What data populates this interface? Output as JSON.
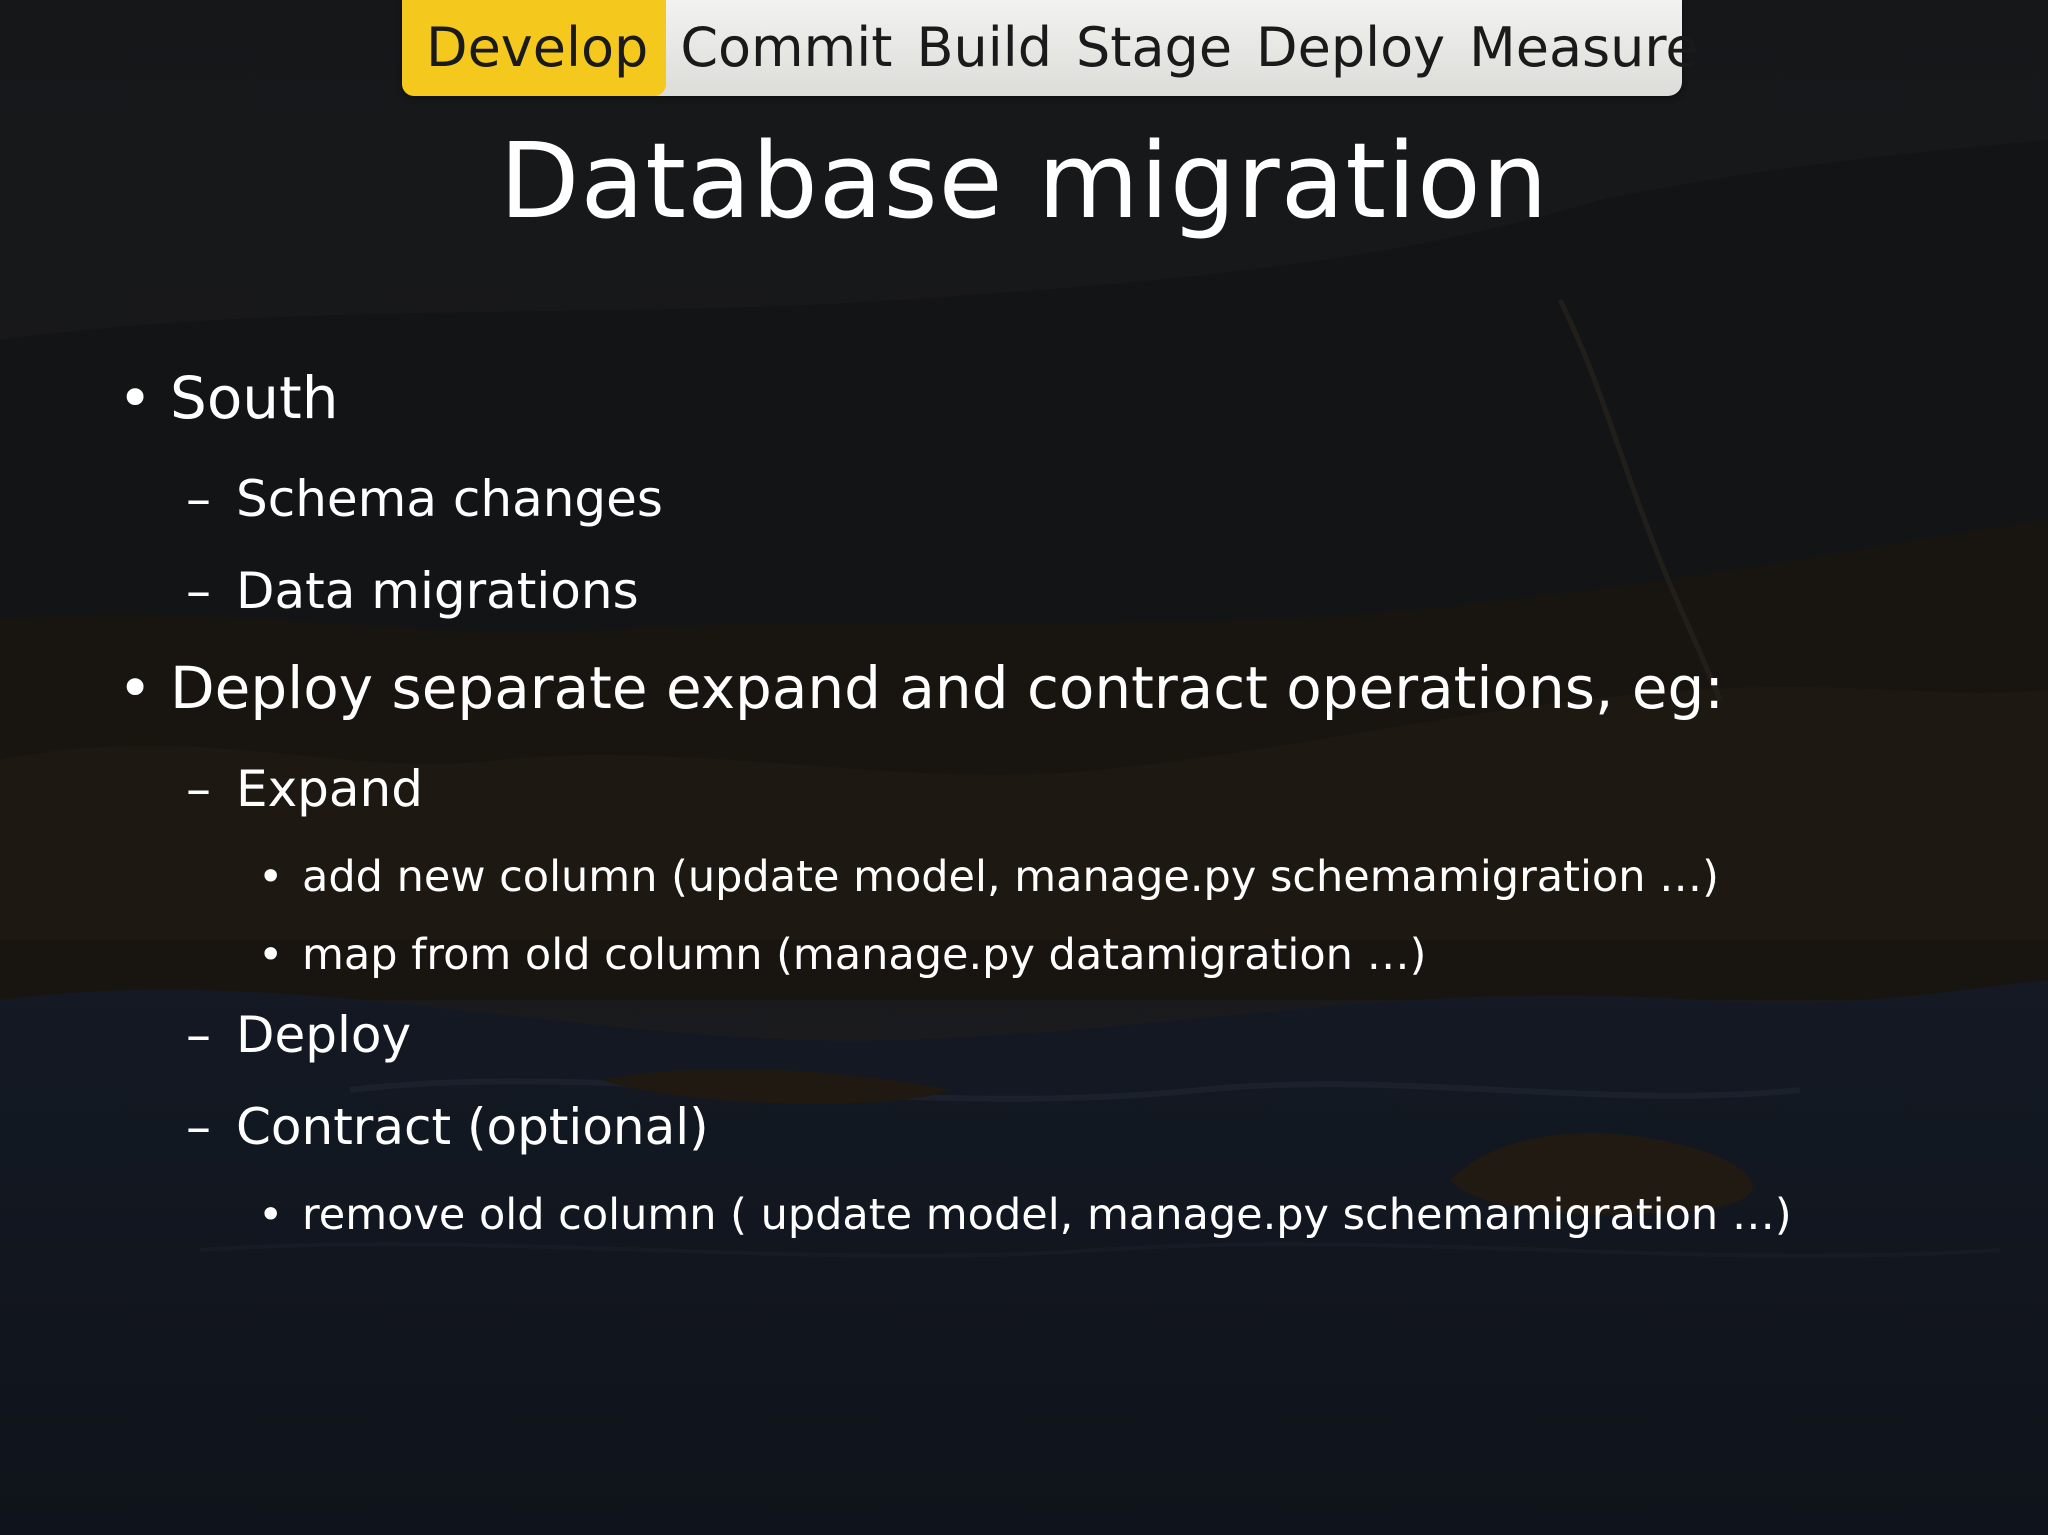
{
  "nav": {
    "items": [
      "Develop",
      "Commit",
      "Build",
      "Stage",
      "Deploy",
      "Measure"
    ],
    "active": "Develop",
    "active_color": "#f4c81c"
  },
  "slide": {
    "title": "Database migration",
    "bullets": [
      {
        "marker": "•",
        "text": "South",
        "children": [
          {
            "marker": "–",
            "text": "Schema changes",
            "children": []
          },
          {
            "marker": "–",
            "text": "Data migrations",
            "children": []
          }
        ]
      },
      {
        "marker": "•",
        "text": "Deploy separate expand and contract operations, eg:",
        "children": [
          {
            "marker": "–",
            "text": "Expand",
            "children": [
              {
                "marker": "•",
                "text": "add new column (update model, manage.py schemamigration …)"
              },
              {
                "marker": "•",
                "text": "map from old column (manage.py datamigration …)"
              }
            ]
          },
          {
            "marker": "–",
            "text": "Deploy",
            "children": []
          },
          {
            "marker": "–",
            "text": "Contract (optional)",
            "children": [
              {
                "marker": "•",
                "text": "remove old column ( update model, manage.py schemamigration …)"
              }
            ]
          }
        ]
      }
    ]
  }
}
